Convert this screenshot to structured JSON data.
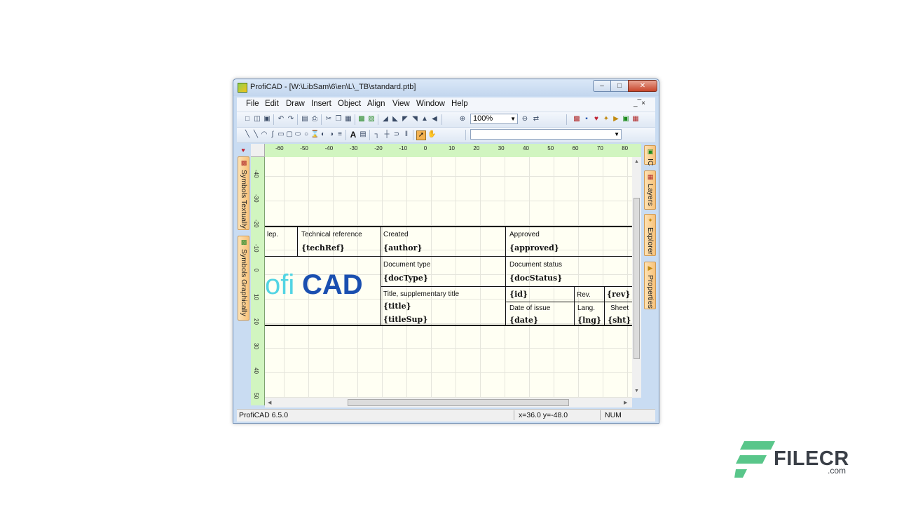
{
  "window": {
    "title": "ProfiCAD - [W:\\LibSam\\6\\en\\L\\_TB\\standard.ptb]",
    "min_label": "–",
    "max_label": "□",
    "close_label": "✕"
  },
  "menu": {
    "items": [
      "File",
      "Edit",
      "Draw",
      "Insert",
      "Object",
      "Align",
      "View",
      "Window",
      "Help"
    ],
    "mdi_controls": "_ ̅ ×"
  },
  "toolbar": {
    "zoom_value": "100%",
    "zoom_arrow": "▼",
    "layer_arrow": "▼"
  },
  "left_tabs": [
    "Symbols Textually",
    "Symbols Graphically"
  ],
  "right_tabs": [
    "IC",
    "Layers",
    "Explorer",
    "Properties"
  ],
  "ruler": {
    "top_ticks": [
      "-60",
      "-50",
      "-40",
      "-30",
      "-20",
      "-10",
      "0",
      "10",
      "20",
      "30",
      "40",
      "50",
      "60",
      "70",
      "80"
    ],
    "left_ticks": [
      "-40",
      "-30",
      "-20",
      "-10",
      "0",
      "10",
      "20",
      "30",
      "40",
      "50"
    ]
  },
  "title_block": {
    "dep_label": "lep.",
    "tech_ref_label": "Technical reference",
    "tech_ref_field": "{techRef}",
    "created_label": "Created",
    "created_field": "{author}",
    "approved_label": "Approved",
    "approved_field": "{approved}",
    "doc_type_label": "Document type",
    "doc_type_field": "{docType}",
    "doc_status_label": "Document status",
    "doc_status_field": "{docStatus}",
    "title_label": "Title, supplementary title",
    "title_field": "{title}",
    "title_sup_field": "{titleSup}",
    "id_field": "{id}",
    "rev_label": "Rev.",
    "rev_field": "{rev}",
    "date_label": "Date of issue",
    "date_field": "{date}",
    "lang_label": "Lang.",
    "lang_field": "{lng}",
    "sheet_label": "Sheet",
    "sheet_field": "{sht}",
    "logo_part1": "ofi",
    "logo_part2": "CAD"
  },
  "status": {
    "version": "ProfiCAD 6.5.0",
    "coords": "x=36.0  y=-48.0",
    "num": "NUM"
  },
  "watermark": {
    "name": "FILECR",
    "suffix": ".com"
  }
}
